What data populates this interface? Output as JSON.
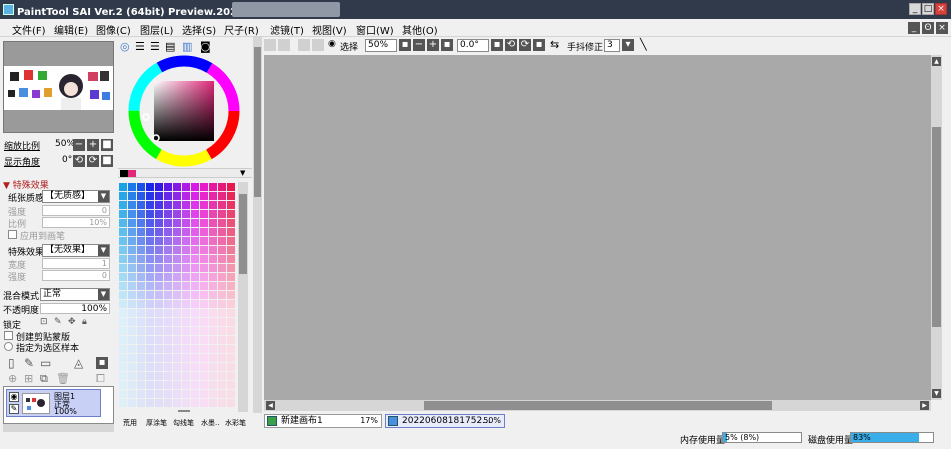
{
  "titlebar": {
    "title": "PaintTool SAI Ver.2 (64bit) Preview.2022.05.27 - 桌面",
    "min": "_",
    "max": "□",
    "close": "×"
  },
  "menu": {
    "items": [
      "文件(F)",
      "编辑(E)",
      "图像(C)",
      "图层(L)",
      "选择(S)",
      "尺子(R)",
      "滤镜(T)",
      "视图(V)",
      "窗口(W)",
      "其他(O)"
    ],
    "mdi_min": "_",
    "mdi_restore": "ʘ",
    "mdi_close": "×"
  },
  "navigator": {
    "zoom_label": "缩放比例",
    "zoom_value": "50%",
    "angle_label": "显示角度",
    "angle_value": "0°",
    "minus": "−",
    "plus": "+",
    "reset": "■"
  },
  "effects": {
    "header": "▼ 特殊效果",
    "paper_label": "纸张质感",
    "paper_value": "【无质感】",
    "strength_label": "强度",
    "strength_value": "0",
    "scale_label": "比例",
    "scale_value": "10%",
    "apply_brush": "应用到画笔",
    "effect_label": "特殊效果",
    "effect_value": "【无效果】",
    "width_label": "宽度",
    "width_value": "1",
    "intensity_label": "强度",
    "intensity_value": "0"
  },
  "layer_props": {
    "blend_label": "混合模式",
    "blend_value": "正常",
    "opacity_label": "不透明度",
    "opacity_value": "100%",
    "lock_label": "锁定",
    "clipping": "创建剪贴蒙版",
    "selection_source": "指定为选区样本"
  },
  "layer": {
    "name": "图层1",
    "mode": "正常",
    "opacity": "100%"
  },
  "brushes": [
    "笔",
    "铅笔",
    "喷枪",
    "水彩笔"
  ],
  "brush_labels": [
    "荒用",
    "厚涂笔",
    "勾线笔",
    "水墨..",
    "水彩笔"
  ],
  "toolbar": {
    "selection_label": "选择",
    "zoom_value": "50%",
    "angle_value": "0.0°",
    "stabilizer_label": "手抖修正",
    "stabilizer_value": "3"
  },
  "documents": [
    {
      "name": "新建画布1",
      "zoom": "17%"
    },
    {
      "name": "20220608181752...",
      "zoom": "50%"
    }
  ],
  "status": {
    "memory_label": "内存使用量",
    "memory_value": "5% (8%)",
    "memory_fraction": 0.05,
    "disk_label": "磁盘使用量",
    "disk_value": "83%",
    "disk_fraction": 0.83
  },
  "colors": {
    "titlebar": "#303a4a",
    "canvas": "#a9a9a9",
    "accent": "#3aaee8",
    "layer_selected": "#c8d0f6"
  }
}
